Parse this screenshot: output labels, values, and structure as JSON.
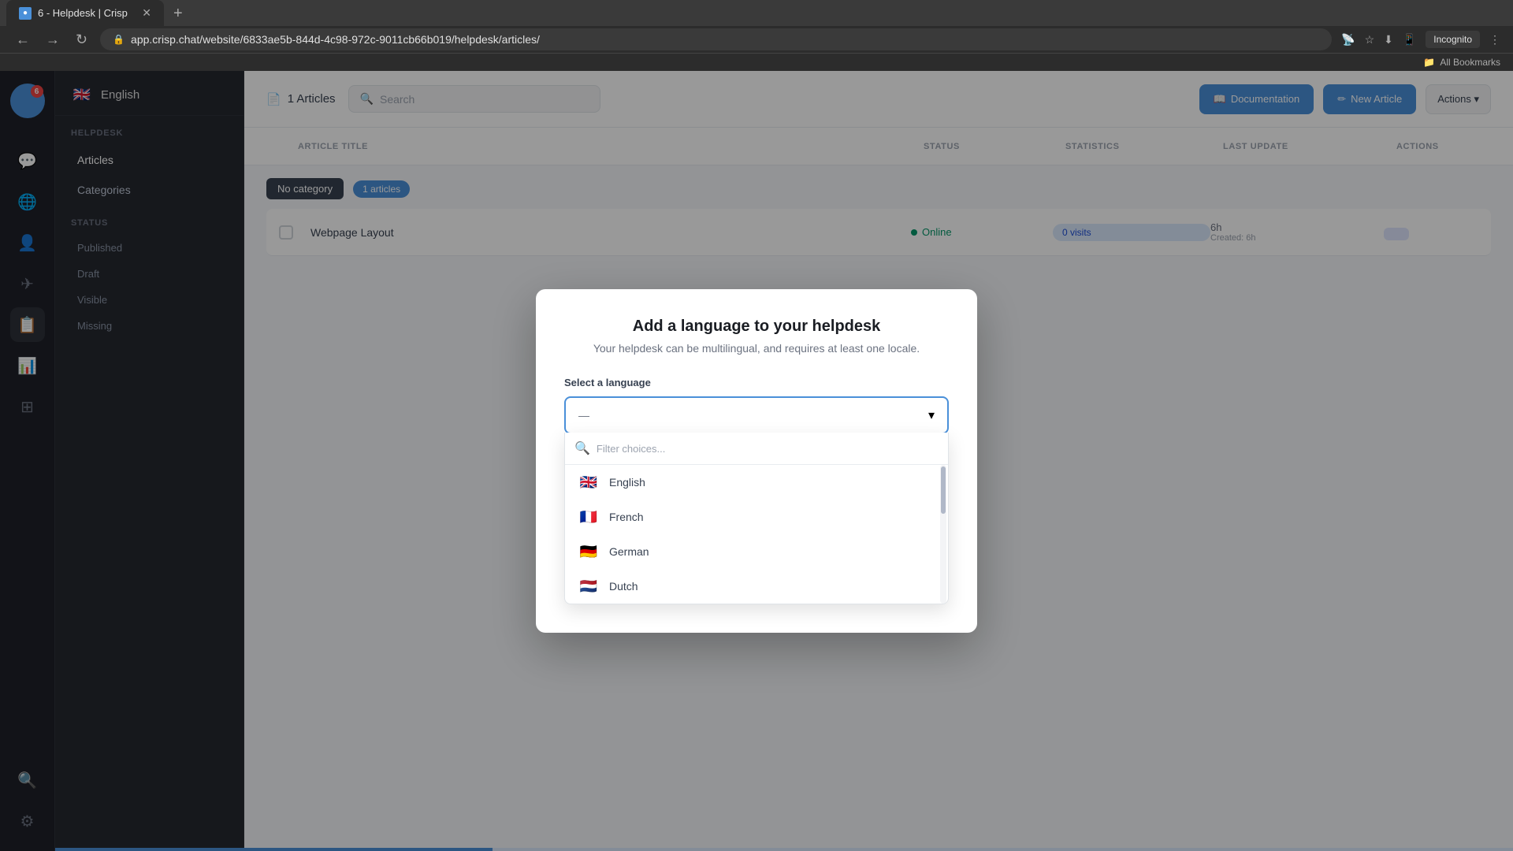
{
  "browser": {
    "tab_title": "6 - Helpdesk | Crisp",
    "tab_favicon": "●",
    "url": "app.crisp.chat/website/6833ae5b-844d-4c98-972c-9011cb66b019/helpdesk/articles/",
    "incognito_label": "Incognito",
    "bookmarks_label": "All Bookmarks"
  },
  "sidebar_icons": {
    "avatar_initials": "",
    "notification_count": "6",
    "icons": [
      "chat",
      "globe",
      "user",
      "send",
      "clipboard",
      "chart",
      "grid",
      "search",
      "settings"
    ]
  },
  "nav_sidebar": {
    "language_label": "English",
    "flag": "🇬🇧",
    "sections": {
      "helpdesk_label": "HELPDESK",
      "articles_label": "Articles",
      "categories_label": "Categories",
      "status_label": "STATUS",
      "published_label": "Published",
      "draft_label": "Draft",
      "visible_label": "Visible",
      "missing_label": "Missing"
    }
  },
  "main_header": {
    "articles_icon": "📄",
    "articles_count": "1 Articles",
    "search_placeholder": "Search",
    "doc_btn": "Documentation",
    "new_article_btn": "New Article",
    "actions_btn": "Actions"
  },
  "table": {
    "columns": [
      "",
      "ARTICLE TITLE",
      "STATUS",
      "STATISTICS",
      "LAST UPDATE",
      "ACTIONS"
    ],
    "category_label": "No category",
    "articles_badge": "1 articles",
    "row": {
      "title": "Webpage Layout",
      "status": "Online",
      "visits": "0 visits",
      "last_update_time": "6h",
      "last_update_label": "Created: 6h"
    }
  },
  "modal": {
    "title": "Add a language to your helpdesk",
    "subtitle": "Your helpdesk can be multilingual, and requires at least one locale.",
    "select_label": "Select a language",
    "select_placeholder": "—",
    "filter_placeholder": "Filter choices...",
    "languages": [
      {
        "name": "English",
        "flag": "🇬🇧"
      },
      {
        "name": "French",
        "flag": "🇫🇷"
      },
      {
        "name": "German",
        "flag": "🇩🇪"
      },
      {
        "name": "Dutch",
        "flag": "🇳🇱"
      }
    ]
  }
}
